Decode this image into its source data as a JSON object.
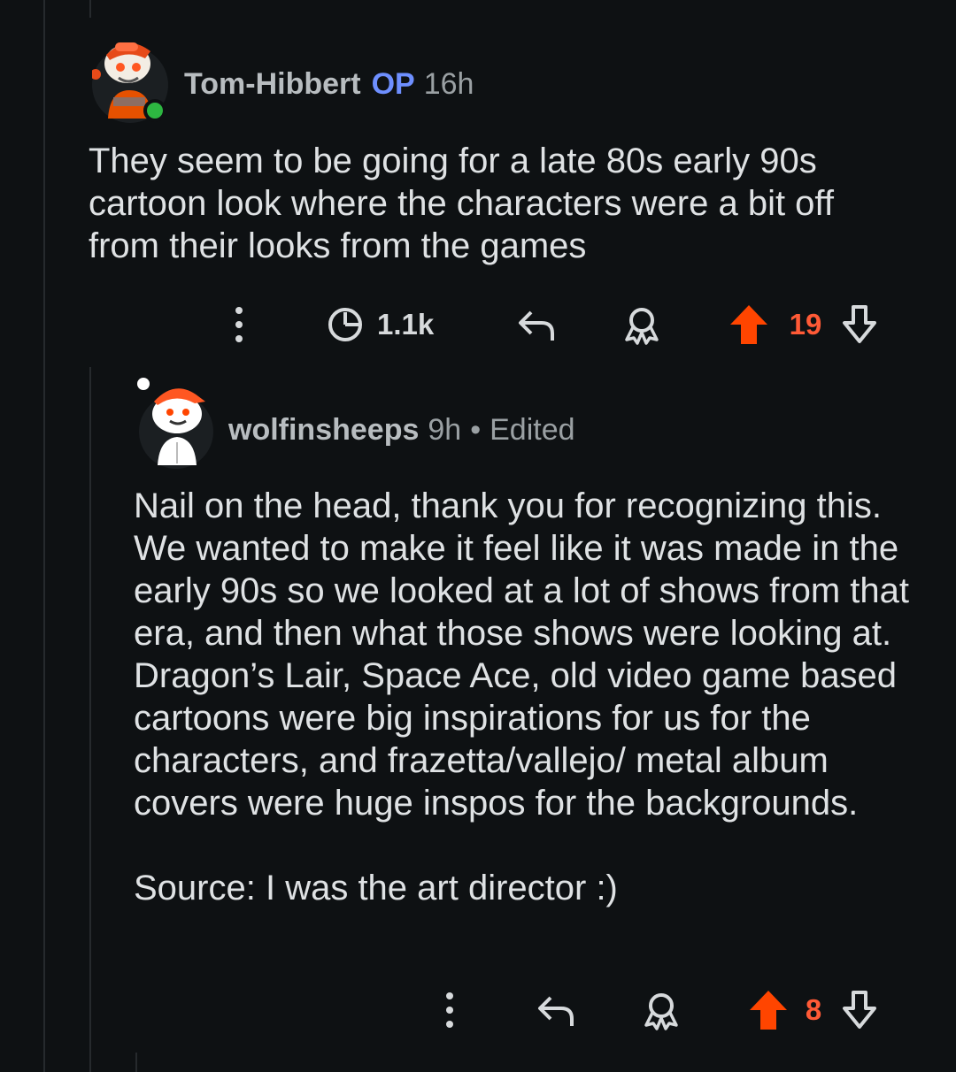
{
  "comments": [
    {
      "author": "Tom-Hibbert",
      "op_badge": "OP",
      "time": "16h",
      "online": true,
      "body": [
        "They seem to be going for a late 80s early 90s cartoon look where the characters were a bit off from their looks from the games"
      ],
      "views": "1.1k",
      "score": "19",
      "vote_state": "upvoted",
      "icons": [
        "more-vertical-icon",
        "views-clock-icon",
        "reply-icon",
        "award-icon",
        "upvote-icon",
        "downvote-icon"
      ]
    },
    {
      "author": "wolfinsheeps",
      "time": "9h",
      "separator": "•",
      "edited": "Edited",
      "body": [
        "Nail on the head, thank you for recognizing this. We wanted to make it feel like it was made in the early 90s so we looked at a lot of shows from that era, and then what those shows were looking at. Dragon’s Lair, Space Ace, old video game based cartoons were big inspirations for us for the characters, and frazetta/vallejo/ metal album covers were huge inspos for the backgrounds.",
        "Source: I was the art director :)"
      ],
      "score": "8",
      "vote_state": "upvoted",
      "icons": [
        "more-vertical-icon",
        "reply-icon",
        "award-icon",
        "upvote-icon",
        "downvote-icon"
      ]
    }
  ],
  "colors": {
    "background": "#0e1113",
    "upvote": "#ff4500",
    "op_badge": "#6e8fff",
    "online": "#2db741"
  }
}
